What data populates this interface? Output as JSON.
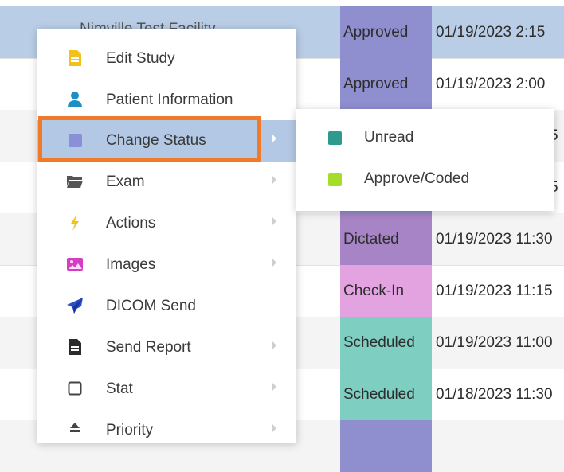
{
  "worklist": {
    "rows": [
      {
        "name": "Nimville Test Facility",
        "status": "Approved",
        "status_color": "#8f8fcf",
        "date": "01/19/2023 2:15"
      },
      {
        "name": "",
        "status": "Approved",
        "status_color": "#8f8fcf",
        "date": "01/19/2023 2:00"
      },
      {
        "name": "",
        "status": "",
        "status_color": "#8f8fcf",
        "date": "01/19/2023 5"
      },
      {
        "name": "",
        "status": "",
        "status_color": "#8f8fcf",
        "date": "01/19/2023 5"
      },
      {
        "name": "",
        "status": "Dictated",
        "status_color": "#a784c6",
        "date": "01/19/2023 11:30"
      },
      {
        "name": "",
        "status": "Check-In",
        "status_color": "#e2a3e0",
        "date": "01/19/2023 11:15"
      },
      {
        "name": "",
        "status": "Scheduled",
        "status_color": "#7ecfc2",
        "date": "01/19/2023 11:00"
      },
      {
        "name": "",
        "status": "Scheduled",
        "status_color": "#7ecfc2",
        "date": "01/18/2023 11:30"
      },
      {
        "name": "",
        "status": "",
        "status_color": "#8f8fcf",
        "date": ""
      }
    ]
  },
  "menu": {
    "items": [
      {
        "label": "Edit Study",
        "icon": "document-icon",
        "icon_color": "#f2c21b",
        "submenu": false
      },
      {
        "label": "Patient Information",
        "icon": "person-icon",
        "icon_color": "#1e8fc6",
        "submenu": false
      },
      {
        "label": "Change Status",
        "icon": "status-square-icon",
        "icon_color": "#8b8fd6",
        "submenu": true
      },
      {
        "label": "Exam",
        "icon": "folder-icon",
        "icon_color": "#555555",
        "submenu": true
      },
      {
        "label": "Actions",
        "icon": "lightning-icon",
        "icon_color": "#f2c21b",
        "submenu": true
      },
      {
        "label": "Images",
        "icon": "image-icon",
        "icon_color": "#d63cc4",
        "submenu": true
      },
      {
        "label": "DICOM Send",
        "icon": "paper-plane-icon",
        "icon_color": "#2a4fc9",
        "submenu": false
      },
      {
        "label": "Send Report",
        "icon": "report-icon",
        "icon_color": "#2b2b2b",
        "submenu": true
      },
      {
        "label": "Stat",
        "icon": "checkbox-icon",
        "icon_color": "#444444",
        "submenu": true
      },
      {
        "label": "Priority",
        "icon": "priority-icon",
        "icon_color": "#444444",
        "submenu": true
      }
    ]
  },
  "submenu": {
    "items": [
      {
        "label": "Unread",
        "color": "#2e9a8e"
      },
      {
        "label": "Approve/Coded",
        "color": "#a6dd2a"
      }
    ]
  },
  "colors": {
    "selected_row": "#b9cde6",
    "active_menu_item": "#b3c8e4",
    "highlight_border": "#f07a27"
  }
}
